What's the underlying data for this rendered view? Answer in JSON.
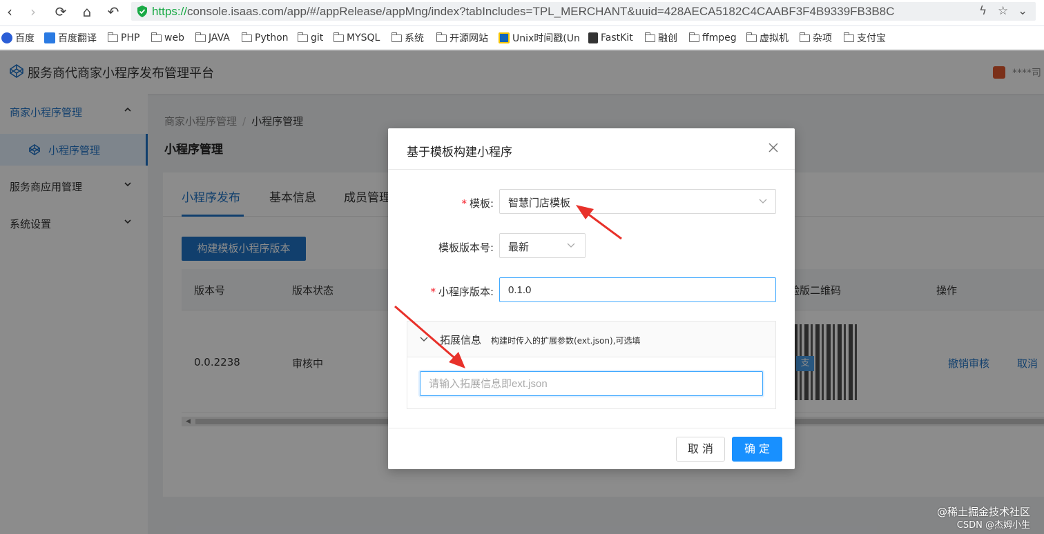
{
  "browser": {
    "url_scheme": "https://",
    "url_rest": "console.isaas.com/app/#/appRelease/appMng/index?tabIncludes=TPL_MERCHANT&uuid=428AECA5182C4CAABF3F4B9339FB3B8C",
    "bookmarks": [
      "百度",
      "百度翻译",
      "PHP",
      "web",
      "JAVA",
      "Python",
      "git",
      "MYSQL",
      "系统",
      "开源网站",
      "Unix时间戳(Un",
      "FastKit",
      "融创",
      "ffmpeg",
      "虚拟机",
      "杂项",
      "支付宝"
    ]
  },
  "app": {
    "title": "服务商代商家小程序发布管理平台",
    "user_name": "****司"
  },
  "sidebar": {
    "groups": [
      {
        "label": "商家小程序管理",
        "expanded": true,
        "items": [
          {
            "label": "小程序管理"
          }
        ]
      },
      {
        "label": "服务商应用管理",
        "expanded": false
      },
      {
        "label": "系统设置",
        "expanded": false
      }
    ]
  },
  "breadcrumb": {
    "parent": "商家小程序管理",
    "current": "小程序管理"
  },
  "page_title": "小程序管理",
  "tabs": [
    "小程序发布",
    "基本信息",
    "成员管理"
  ],
  "build_button": "构建模板小程序版本",
  "table": {
    "columns": [
      "版本号",
      "版本状态",
      "验版二维码",
      "操作"
    ],
    "row": {
      "version": "0.0.2238",
      "status": "审核中",
      "actions": [
        "撤销审核",
        "取消"
      ]
    }
  },
  "modal": {
    "title": "基于模板构建小程序",
    "template_label": "模板:",
    "template_value": "智慧门店模板",
    "template_version_label": "模板版本号:",
    "template_version_value": "最新",
    "app_version_label": "小程序版本:",
    "app_version_value": "0.1.0",
    "ext_title": "拓展信息",
    "ext_desc": "构建时传入的扩展参数(ext.json),可选填",
    "ext_placeholder": "请输入拓展信息即ext.json",
    "cancel": "取 消",
    "ok": "确 定"
  },
  "qr_badge": "支",
  "watermark": {
    "line1": "@稀土掘金技术社区",
    "line2": "CSDN @杰姆小生"
  },
  "colors": {
    "primary": "#1f73c7",
    "ok_button": "#1890ff",
    "required": "#f5222d",
    "annotation_arrow": "#e8312a"
  }
}
